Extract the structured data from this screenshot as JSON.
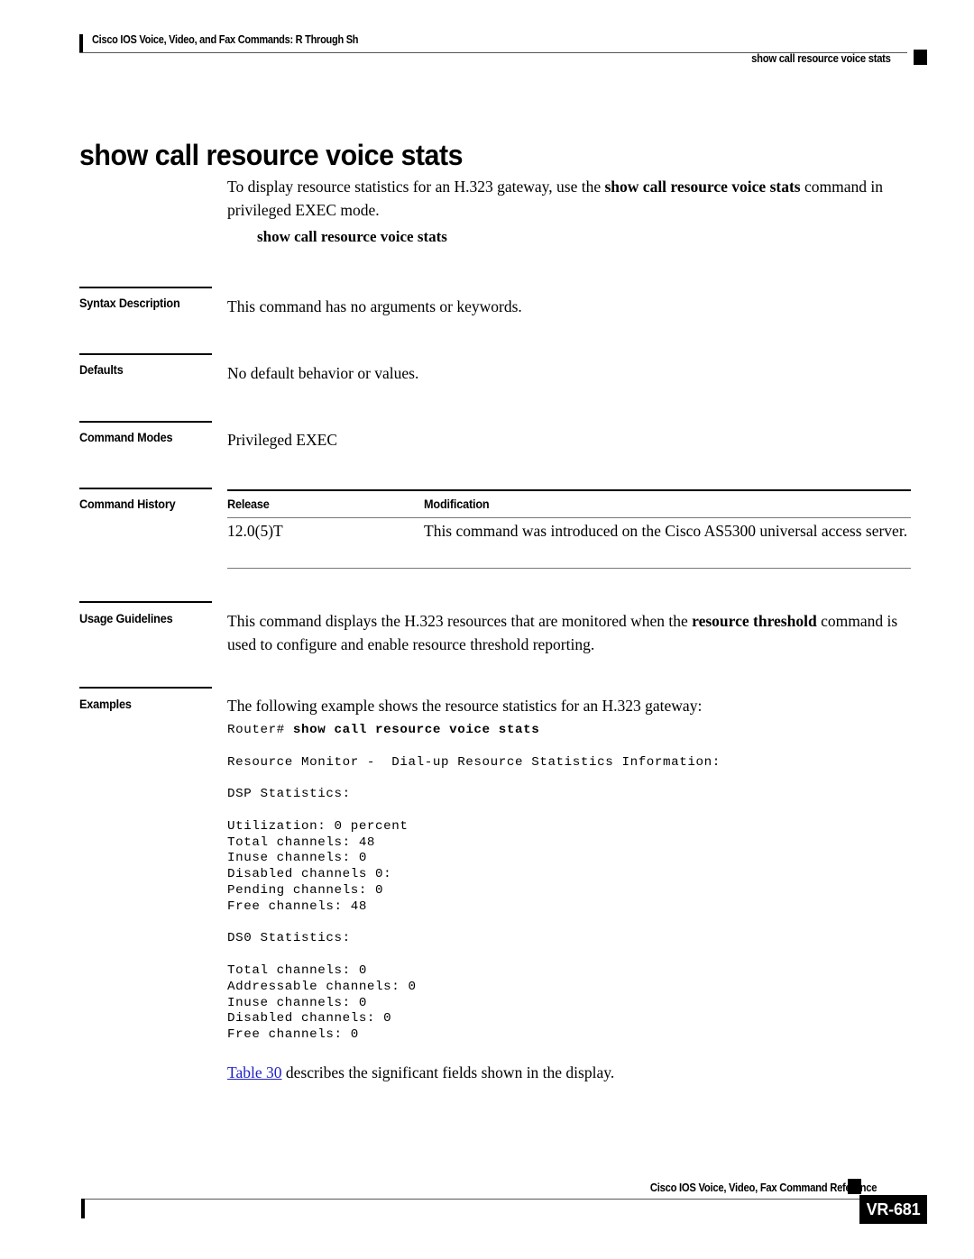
{
  "header": {
    "book_title": "Cisco IOS Voice, Video, and Fax Commands: R Through Sh",
    "command_name": "show call resource voice stats"
  },
  "title": "show call resource voice stats",
  "intro": {
    "part1": "To display resource statistics for an H.323 gateway, use the ",
    "command": "show call resource voice stats",
    "part2": " command in privileged EXEC mode."
  },
  "syntax_line": "show call resource voice stats",
  "sections": {
    "syntax_description": {
      "label": "Syntax Description",
      "text": "This command has no arguments or keywords."
    },
    "defaults": {
      "label": "Defaults",
      "text": "No default behavior or values."
    },
    "command_modes": {
      "label": "Command Modes",
      "text": "Privileged EXEC"
    },
    "command_history": {
      "label": "Command History",
      "columns": [
        "Release",
        "Modification"
      ],
      "rows": [
        {
          "release": "12.0(5)T",
          "modification": "This command was introduced on the Cisco AS5300 universal access server."
        }
      ]
    },
    "usage_guidelines": {
      "label": "Usage Guidelines",
      "part1": "This command displays the H.323 resources that are monitored when the ",
      "command": "resource threshold",
      "part2": " command is used to configure and enable resource threshold reporting."
    },
    "examples": {
      "label": "Examples",
      "intro": "The following example shows the resource statistics for an H.323 gateway:",
      "prompt": "Router# ",
      "typed_command": "show call resource voice stats",
      "output_lines": [
        "",
        "Resource Monitor -  Dial-up Resource Statistics Information:",
        "",
        "DSP Statistics:",
        "",
        "Utilization: 0 percent",
        "Total channels: 48",
        "Inuse channels: 0",
        "Disabled channels 0:",
        "Pending channels: 0",
        "Free channels: 48",
        "",
        "DS0 Statistics:",
        "",
        "Total channels: 0",
        "Addressable channels: 0",
        "Inuse channels: 0",
        "Disabled channels: 0",
        "Free channels: 0"
      ]
    }
  },
  "closing": {
    "xref": "Table 30",
    "text": " describes the significant fields shown in the display."
  },
  "footer": {
    "title": "Cisco IOS Voice, Video, Fax Command Reference",
    "page_number": "VR-681"
  },
  "colors": {
    "xref_link": "#2020c8",
    "rule": "#000000",
    "page_box": "#000000"
  }
}
